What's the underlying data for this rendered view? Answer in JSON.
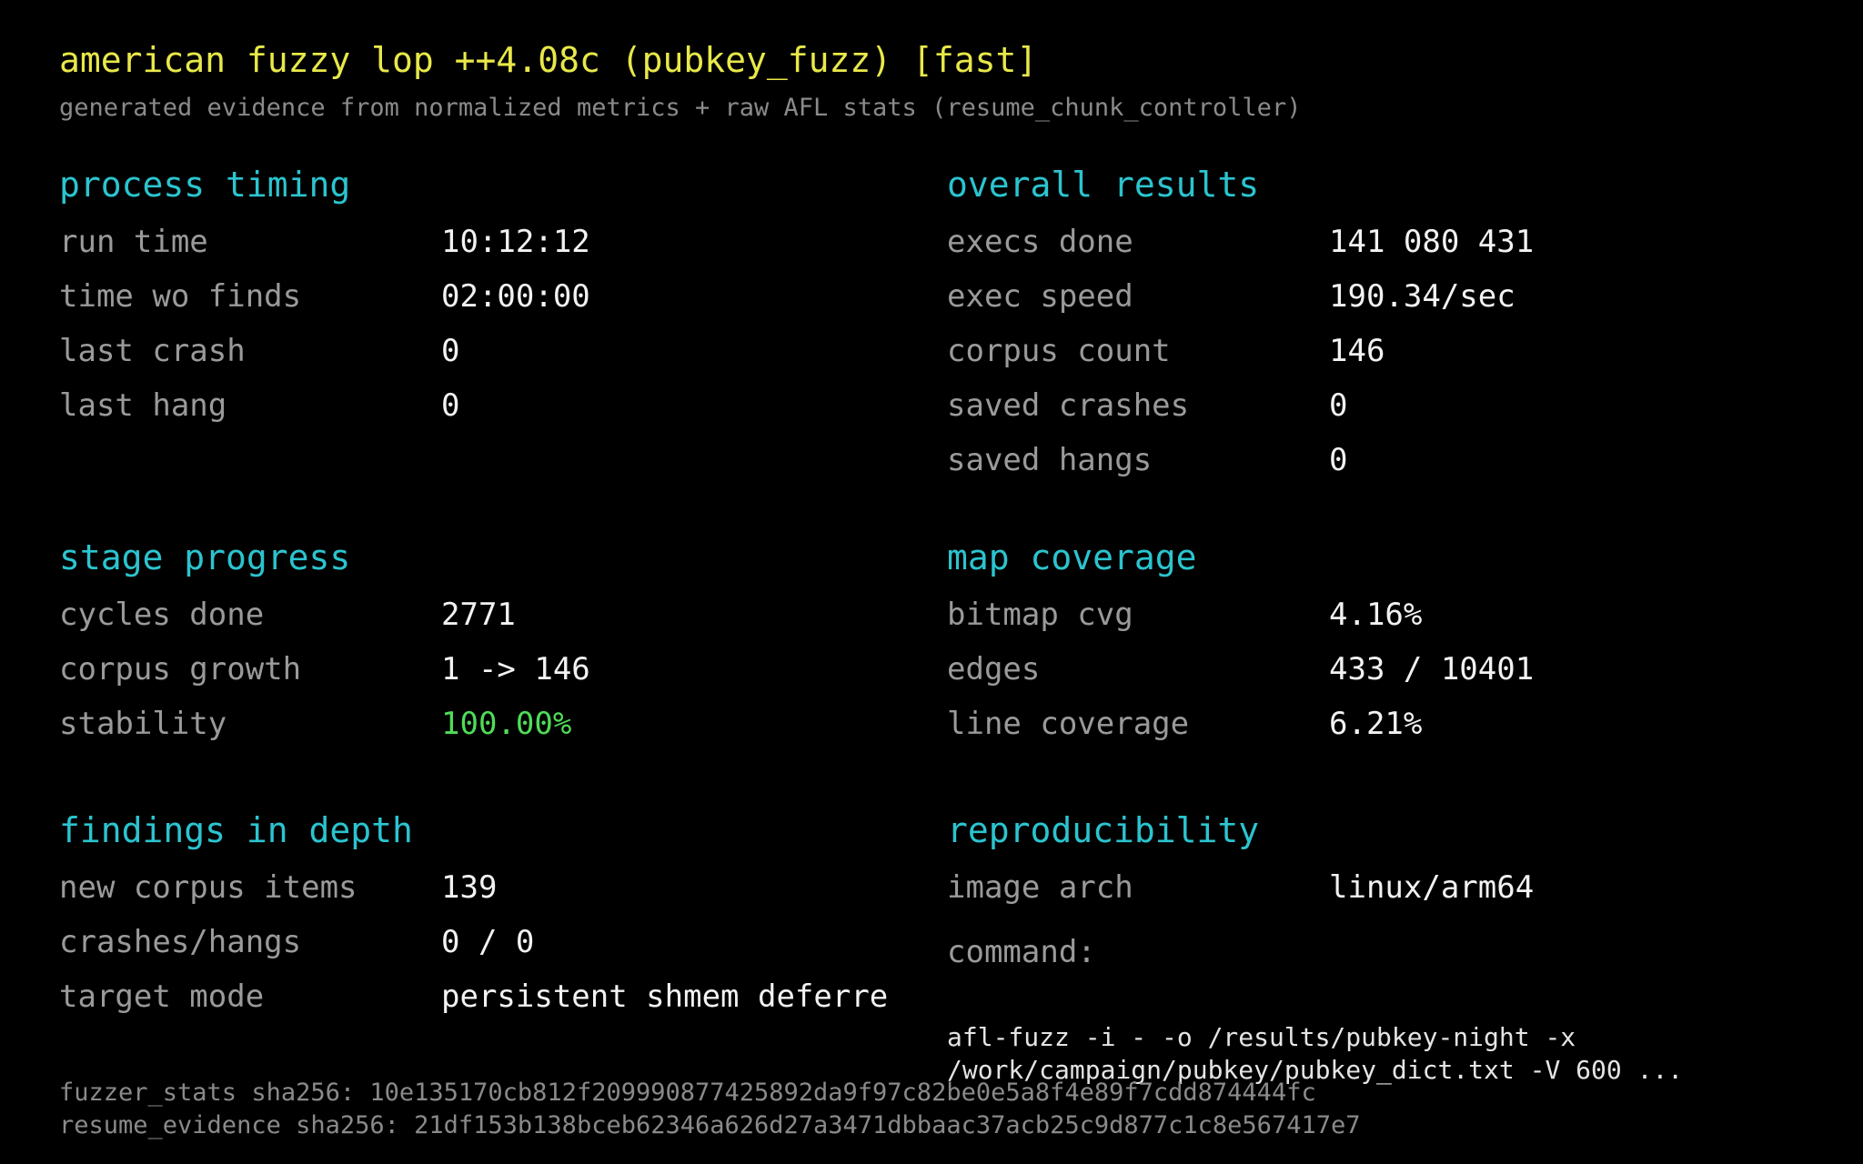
{
  "header": {
    "title": "american fuzzy lop ++4.08c (pubkey_fuzz) [fast]",
    "subtitle": "generated evidence from normalized metrics + raw AFL stats (resume_chunk_controller)"
  },
  "colors": {
    "background": "#000000",
    "title": "#e8e84a",
    "section_heading": "#2bc4cf",
    "label": "#9a9a9a",
    "value": "#f2f2f2",
    "good": "#4fdc58",
    "muted": "#8a8a8a"
  },
  "process_timing": {
    "heading": "process timing",
    "rows": [
      {
        "label": "run time",
        "value": "10:12:12"
      },
      {
        "label": "time wo finds",
        "value": "02:00:00"
      },
      {
        "label": "last crash",
        "value": "0"
      },
      {
        "label": "last hang",
        "value": "0"
      }
    ]
  },
  "overall_results": {
    "heading": "overall results",
    "rows": [
      {
        "label": "execs done",
        "value": "141 080 431"
      },
      {
        "label": "exec speed",
        "value": "190.34/sec"
      },
      {
        "label": "corpus count",
        "value": "146"
      },
      {
        "label": "saved crashes",
        "value": "0"
      },
      {
        "label": "saved hangs",
        "value": "0"
      }
    ]
  },
  "stage_progress": {
    "heading": "stage progress",
    "rows": [
      {
        "label": "cycles done",
        "value": "2771"
      },
      {
        "label": "corpus growth",
        "value": "1 -> 146"
      },
      {
        "label": "stability",
        "value": "100.00%"
      }
    ]
  },
  "map_coverage": {
    "heading": "map coverage",
    "rows": [
      {
        "label": "bitmap cvg",
        "value": "4.16%"
      },
      {
        "label": "edges",
        "value": "433 / 10401"
      },
      {
        "label": "line coverage",
        "value": "6.21%"
      }
    ]
  },
  "findings_in_depth": {
    "heading": "findings in depth",
    "rows": [
      {
        "label": "new corpus items",
        "value": "139"
      },
      {
        "label": "crashes/hangs",
        "value": "0 / 0"
      },
      {
        "label": "target mode",
        "value": "persistent shmem deferre"
      }
    ]
  },
  "reproducibility": {
    "heading": "reproducibility",
    "rows": [
      {
        "label": "image arch",
        "value": "linux/arm64"
      }
    ],
    "command_label": "command:",
    "command_lines": [
      "afl-fuzz -i - -o /results/pubkey-night -x",
      "/work/campaign/pubkey/pubkey_dict.txt -V 600 ..."
    ]
  },
  "footer": {
    "fuzzer_stats_sha": "fuzzer_stats sha256: 10e135170cb812f209990877425892da9f97c82be0e5a8f4e89f7cdd874444fc",
    "resume_evidence_sha": "resume_evidence sha256: 21df153b138bceb62346a626d27a3471dbbaac37acb25c9d877c1c8e567417e7"
  }
}
